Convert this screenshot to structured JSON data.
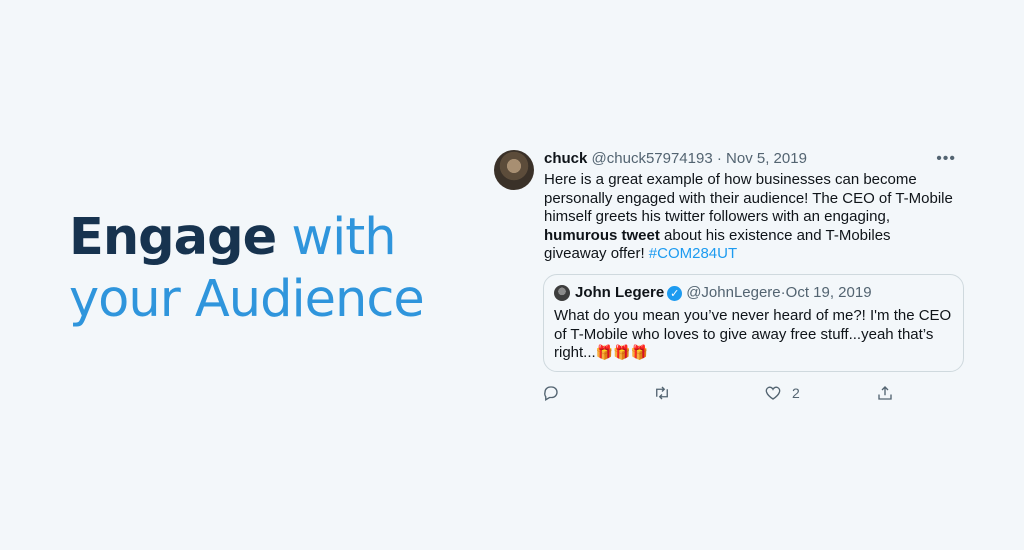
{
  "headline": {
    "bold": "Engage",
    "light1": " with",
    "light2": "your Audience"
  },
  "tweet": {
    "name": "chuck",
    "handle": "@chuck57974193",
    "sep": " · ",
    "date": "Nov 5, 2019",
    "more": "•••",
    "text_part1": "Here is a great example of how businesses can become personally engaged with their audience! The CEO of T-Mobile himself greets his twitter followers with an engaging, ",
    "text_bold": "humurous tweet",
    "text_part2": " about his existence and T-Mobiles giveaway offer! ",
    "hashtag": "#COM284UT",
    "quoted": {
      "name": "John Legere",
      "verified_mark": "✓",
      "handle": "@JohnLegere",
      "sep": " · ",
      "date": "Oct 19, 2019",
      "text": "What do you mean you’ve never heard of me?! I'm the CEO of T-Mobile who loves to give away free stuff...yeah that’s right...",
      "emoji": "🎁🎁🎁"
    },
    "actions": {
      "reply_count": "",
      "retweet_count": "",
      "like_count": "2"
    }
  },
  "colors": {
    "background": "#f3f7fa",
    "headline_dark": "#17334f",
    "headline_blue": "#2f95dc",
    "link_blue": "#1d9bf0"
  },
  "icons": [
    "reply-icon",
    "retweet-icon",
    "like-icon",
    "share-icon",
    "verified-badge-icon",
    "more-icon"
  ]
}
